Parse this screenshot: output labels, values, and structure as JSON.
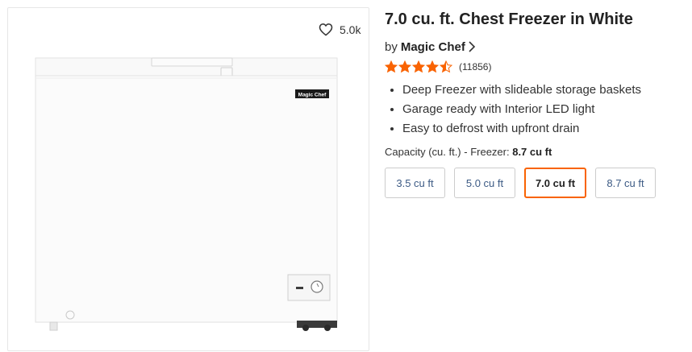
{
  "favorite": {
    "count": "5.0k",
    "icon": "heart-outline-icon"
  },
  "product": {
    "title": "7.0 cu. ft. Chest Freezer in White",
    "by_text": "by",
    "brand": "Magic Chef",
    "image_logo_text": "Magic Chef",
    "rating": {
      "value": 4.5,
      "max": 5,
      "count_text": "(11856)",
      "star_color": "#f96302"
    },
    "bullets": [
      "Deep Freezer with slideable storage baskets",
      "Garage ready with Interior LED light",
      "Easy to defrost with upfront drain"
    ]
  },
  "capacity": {
    "label": "Capacity (cu. ft.) - Freezer:",
    "selected_value": "8.7 cu ft",
    "options": [
      {
        "label": "3.5 cu ft",
        "selected": false
      },
      {
        "label": "5.0 cu ft",
        "selected": false
      },
      {
        "label": "7.0 cu ft",
        "selected": true
      },
      {
        "label": "8.7 cu ft",
        "selected": false
      }
    ]
  },
  "colors": {
    "accent": "#f96302",
    "option_text": "#3c5a84",
    "border": "#cccccc"
  }
}
